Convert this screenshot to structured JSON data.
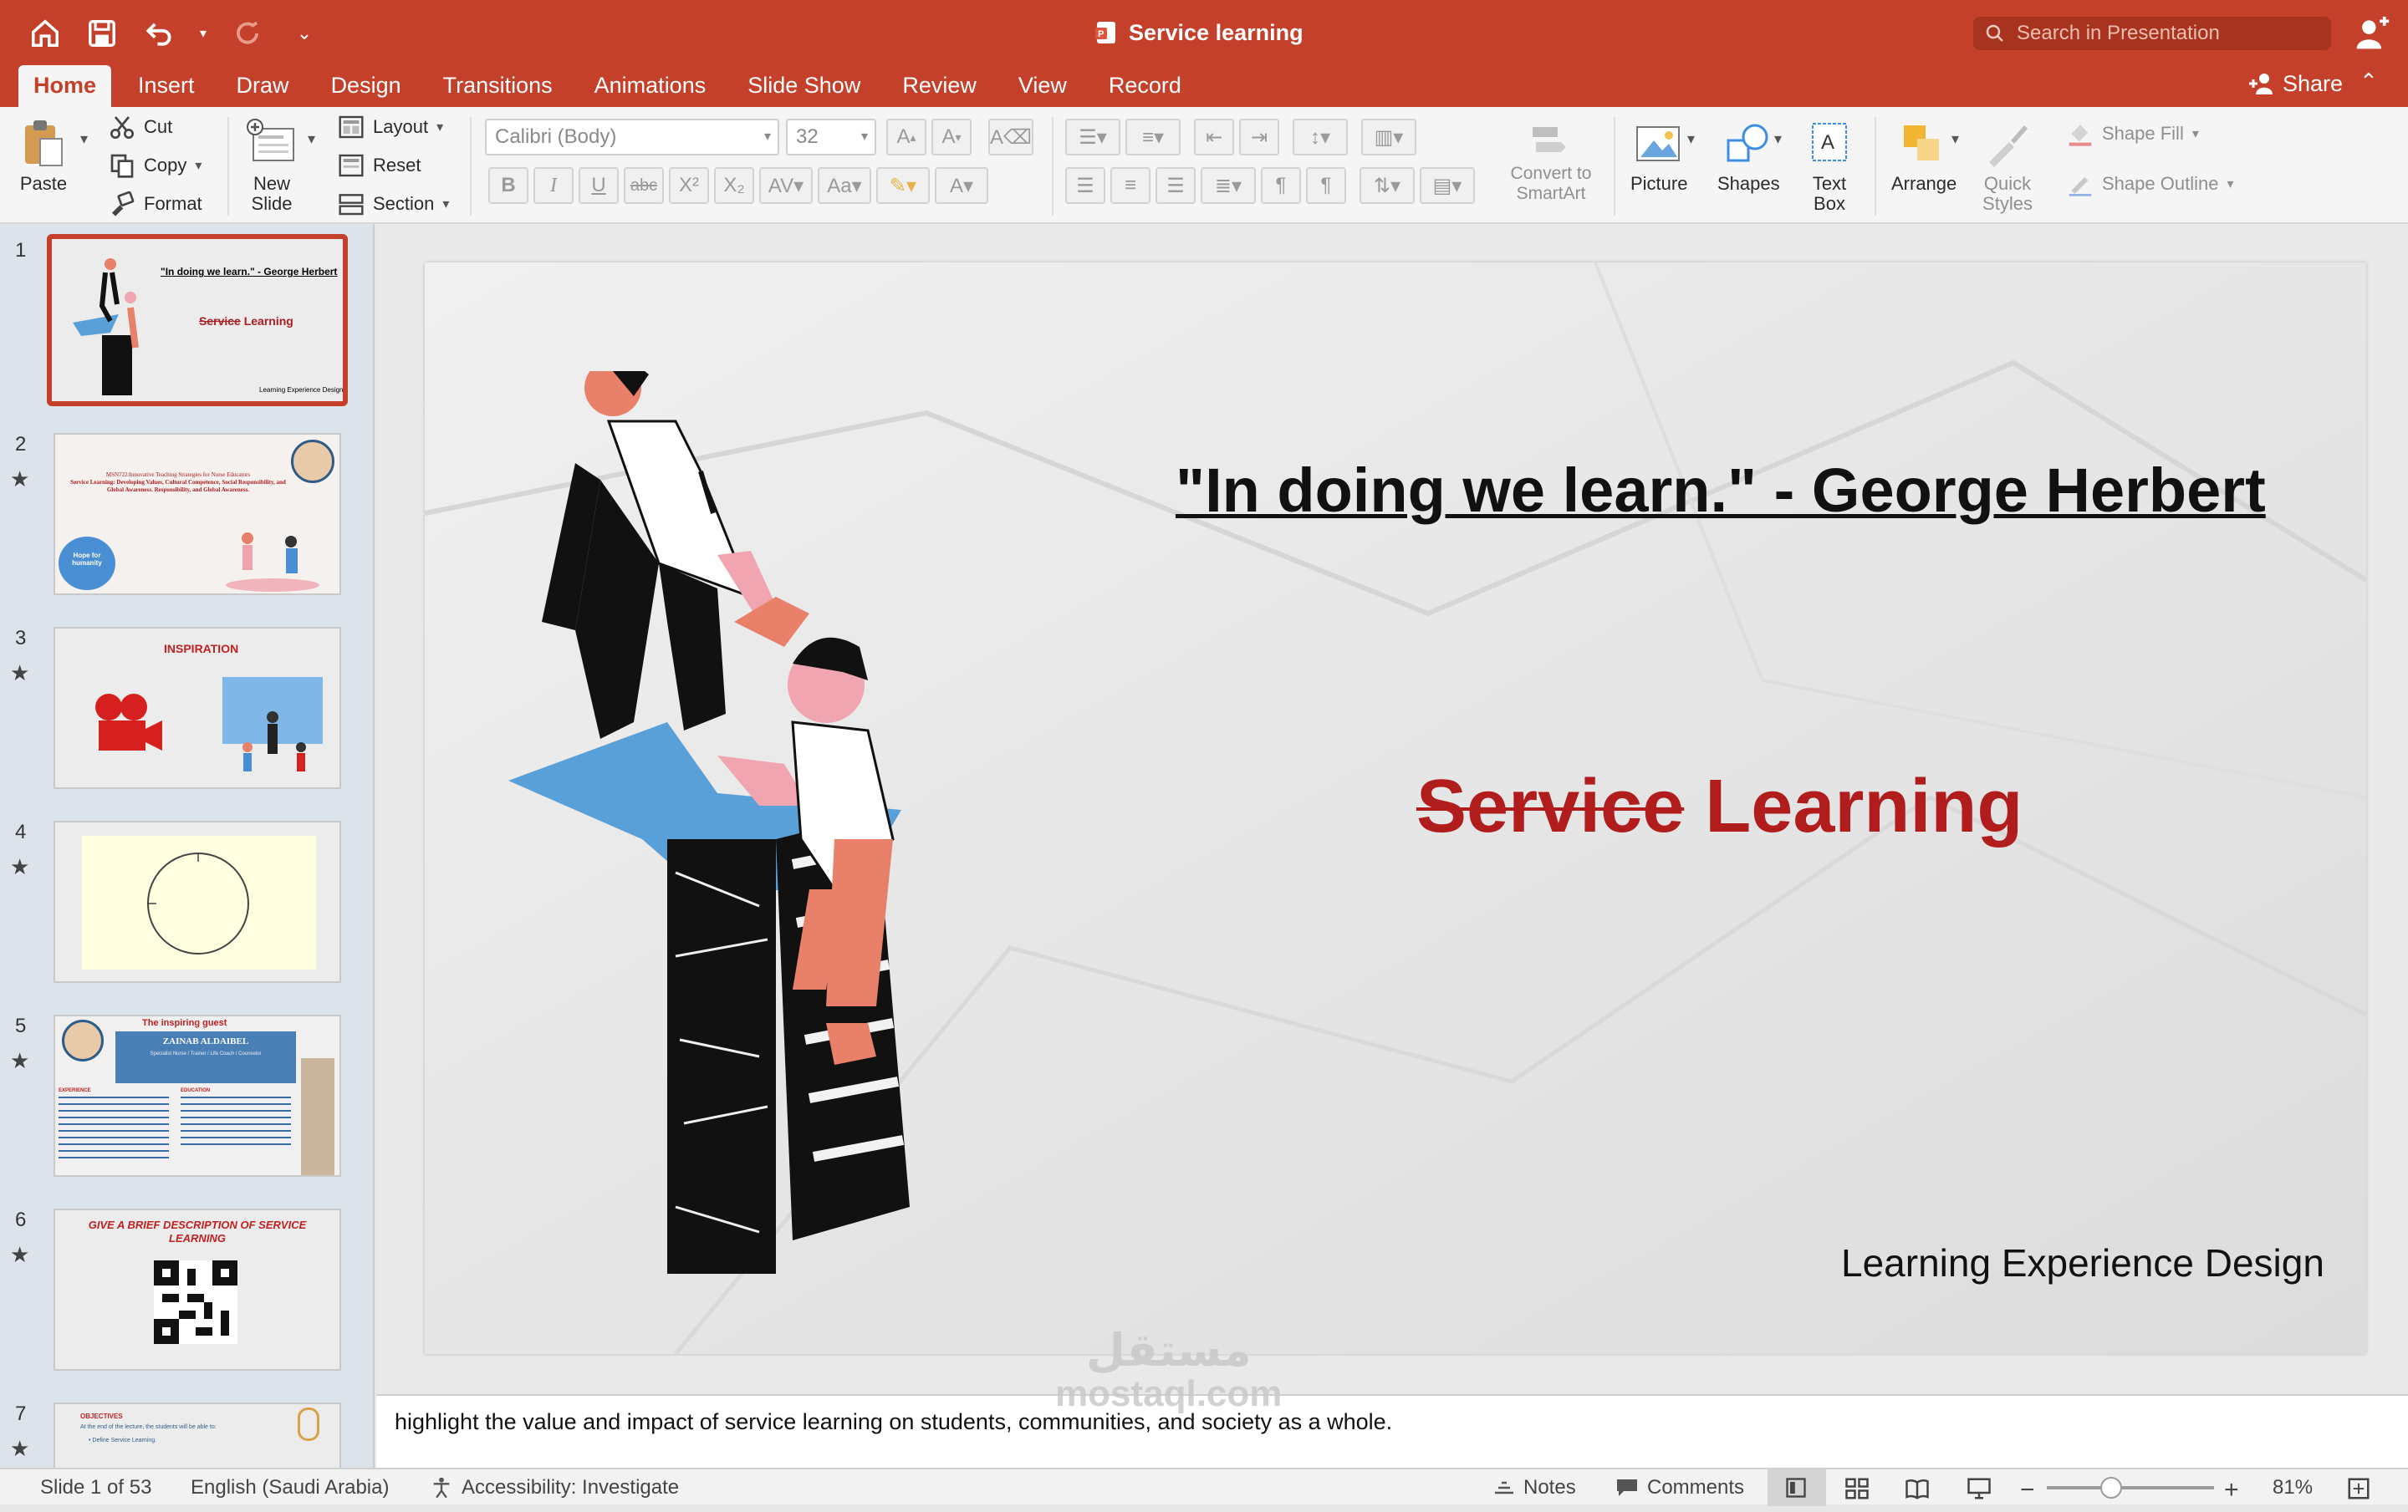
{
  "app": {
    "doc_title": "Service learning",
    "search_placeholder": "Search in Presentation",
    "share_label": "Share"
  },
  "tabs": [
    "Home",
    "Insert",
    "Draw",
    "Design",
    "Transitions",
    "Animations",
    "Slide Show",
    "Review",
    "View",
    "Record"
  ],
  "ribbon": {
    "paste": "Paste",
    "cut": "Cut",
    "copy": "Copy",
    "format": "Format",
    "new_slide": "New Slide",
    "layout": "Layout",
    "reset": "Reset",
    "section": "Section",
    "font_name": "Calibri (Body)",
    "font_size": "32",
    "convert": "Convert to SmartArt",
    "picture": "Picture",
    "shapes": "Shapes",
    "text_box": "Text Box",
    "arrange": "Arrange",
    "quick_styles": "Quick Styles",
    "shape_fill": "Shape Fill",
    "shape_outline": "Shape Outline"
  },
  "thumbnails": {
    "numbers": [
      "1",
      "2",
      "3",
      "4",
      "5",
      "6",
      "7"
    ],
    "slide1_quote": "\"In doing we learn.\" - George Herbert",
    "slide1_title_strike": "Service",
    "slide1_title_rest": "Learning",
    "slide1_footer": "Learning Experience Design",
    "slide2_heading": "MSN722:Innovative Teaching Strategies for Nurse Educators",
    "slide2_sub": "Service Learning: Developing Values, Cultural Competence, Social Responsibility, and Global Awareness. Responsibility, and Global Awareness.",
    "slide2_badge": "Hope for humanity",
    "slide3_title": "INSPIRATION",
    "slide5_title": "The inspiring guest",
    "slide5_name": "ZAINAB ALDAIBEL",
    "slide5_role": "Specialist Nurse / Trainer / Life Coach / Counselor",
    "slide5_exp": "EXPERIENCE",
    "slide5_edu": "EDUCATION",
    "slide6_title": "GIVE A BRIEF DESCRIPTION OF SERVICE LEARNING",
    "slide7_title": "OBJECTIVES",
    "slide7_line1": "At the end of the lecture, the students will be able to:",
    "slide7_line2": "Define Service Learning."
  },
  "slide": {
    "quote": "\"In doing we learn.\" - George Herbert",
    "title_strike": "Service",
    "title_rest": " Learning",
    "footer": "Learning Experience Design"
  },
  "notes": {
    "text": "highlight the value and impact of service learning on students, communities, and society as a whole.",
    "watermark_ar": "مستقل",
    "watermark_en": "mostaql.com"
  },
  "status": {
    "slide_count": "Slide 1 of 53",
    "language": "English (Saudi Arabia)",
    "accessibility": "Accessibility: Investigate",
    "notes": "Notes",
    "comments": "Comments",
    "zoom": "81%"
  },
  "colors": {
    "accent": "#c4402a",
    "title_red": "#b11d1d",
    "figure_salmon": "#e8806a",
    "platform_blue": "#5aa0d8"
  }
}
